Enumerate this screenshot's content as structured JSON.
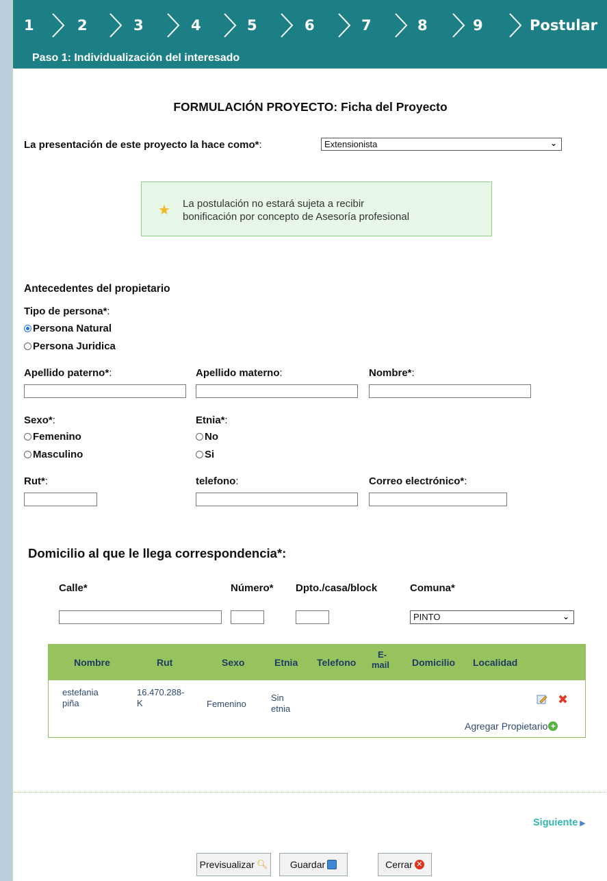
{
  "steps": [
    "1",
    "2",
    "3",
    "4",
    "5",
    "6",
    "7",
    "8",
    "9",
    "Postular"
  ],
  "step_title": "Paso 1: Individualización del interesado",
  "page_heading": "FORMULACIÓN PROYECTO: Ficha del Proyecto",
  "presentation": {
    "label": "La presentación de este proyecto la hace como*",
    "value": "Extensionista"
  },
  "notice": {
    "line1": "La postulación no estará sujeta a recibir",
    "line2": "bonificación por concepto de Asesoría profesional",
    "icon": "star-icon"
  },
  "owner": {
    "section": "Antecedentes del propietario",
    "tipo_label": "Tipo de persona*",
    "tipo_options": [
      "Persona Natural",
      "Persona Juridica"
    ],
    "tipo_selected": 0,
    "apellido_paterno": "Apellido paterno*",
    "apellido_materno": "Apellido materno",
    "nombre": "Nombre*",
    "sexo_label": "Sexo*",
    "sexo_options": [
      "Femenino",
      "Masculino"
    ],
    "etnia_label": "Etnia*",
    "etnia_options": [
      "No",
      "Si"
    ],
    "rut": "Rut*",
    "telefono": "telefono",
    "correo": "Correo electrónico*"
  },
  "address": {
    "title": "Domicilio al que le llega correspondencia*:",
    "calle": "Calle*",
    "numero": "Número*",
    "dpto": "Dpto./casa/block",
    "comuna": "Comuna*",
    "comuna_value": "PINTO"
  },
  "table": {
    "headers": [
      "Nombre",
      "Rut",
      "Sexo",
      "Etnia",
      "Telefono",
      "E-",
      "mail",
      "Domicilio",
      "Localidad"
    ],
    "row": {
      "nombre_1": "estefania",
      "nombre_2": "piña",
      "rut_1": "16.470.288-",
      "rut_2": "K",
      "sexo": "Femenino",
      "etnia_1": "Sin",
      "etnia_2": "etnia"
    },
    "add_label": "Agregar Propietario"
  },
  "next_label": "Siguiente",
  "buttons": {
    "preview": "Previsualizar",
    "save": "Guardar",
    "close": "Cerrar"
  },
  "colors": {
    "teal": "#1d7f86",
    "green_header": "#96c35d",
    "link": "#34b8b0"
  }
}
